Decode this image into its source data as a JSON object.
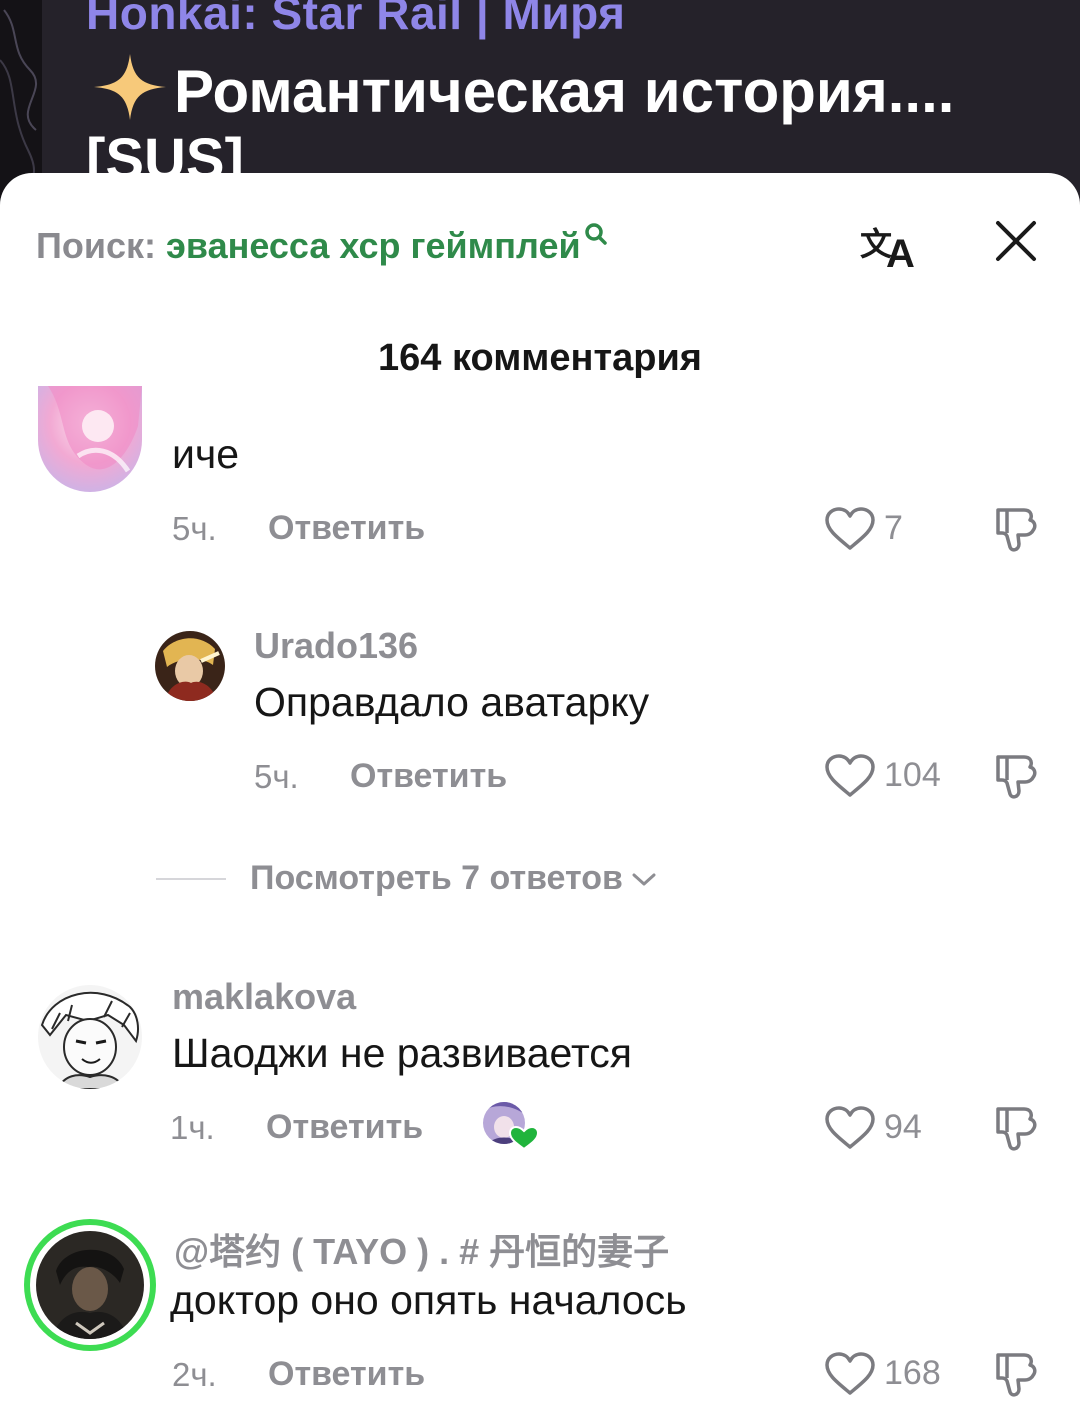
{
  "video": {
    "channel": "Honkai: Star Rail | Миря",
    "title": "Романтическая история....",
    "tag": "[SUS]"
  },
  "sheet": {
    "search_prefix": "Поиск: ",
    "search_query": "эванесса хср геймплей",
    "comment_count": "164 комментария"
  },
  "comments": [
    {
      "username": "",
      "text": "иче",
      "time": "5ч.",
      "reply": "Ответить",
      "likes": "7"
    },
    {
      "username": "Urado136",
      "text": "Оправдало аватарку",
      "time": "5ч.",
      "reply": "Ответить",
      "likes": "104"
    },
    {
      "username": "maklakova",
      "text": "Шаоджи не развивается",
      "time": "1ч.",
      "reply": "Ответить",
      "likes": "94"
    },
    {
      "username": "@塔约 ( TAYO ) . # 丹恒的妻子",
      "text": "доктор оно опять началось",
      "time": "2ч.",
      "reply": "Ответить",
      "likes": "168"
    }
  ],
  "view_replies": "Посмотреть 7 ответов",
  "colors": {
    "accent_green": "#2f8a4a",
    "channel_purple": "#8f86e8",
    "story_ring": "#3ddc52",
    "creator_heart": "#20b43c"
  },
  "icons": [
    "sparkle-icon",
    "search-icon",
    "translate-icon",
    "close-icon",
    "heart-icon",
    "dislike-icon",
    "chevron-down-icon"
  ]
}
